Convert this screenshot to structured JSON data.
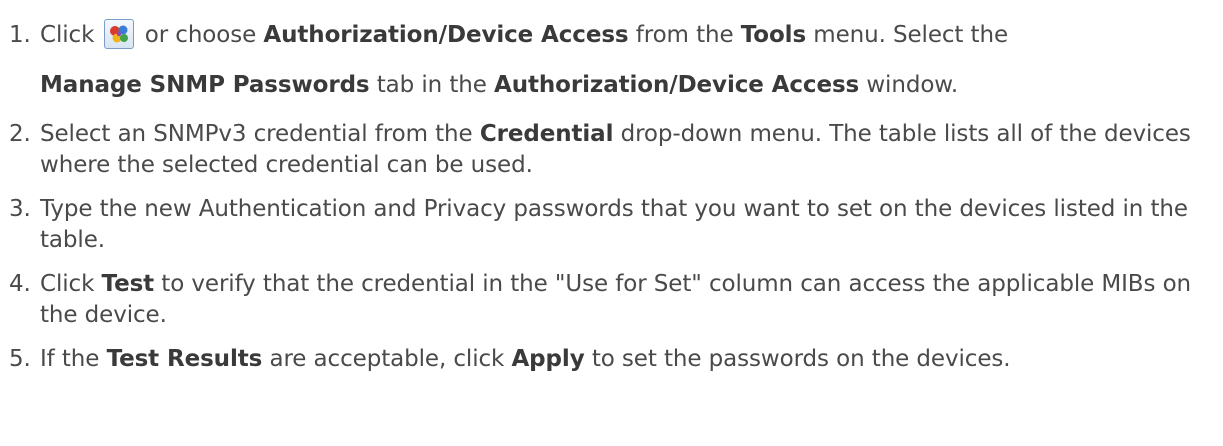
{
  "steps": [
    {
      "num": "1.",
      "click": "Click",
      "or_choose": "or choose",
      "menu_item": "Authorization/Device Access",
      "from_the": "from the",
      "menu": "Tools",
      "menu_suffix": "menu. Select the",
      "tab": "Manage SNMP Passwords",
      "tab_in_the": "tab in the",
      "window_name": "Authorization/Device Access",
      "window_suffix": "window."
    },
    {
      "num": "2.",
      "prefix": "Select an SNMPv3 credential from the",
      "field": "Credential",
      "suffix": "drop-down menu. The table lists all of the devices where the selected credential can be used."
    },
    {
      "num": "3.",
      "text": "Type the new Authentication and Privacy passwords that you want to set on the devices listed in the table."
    },
    {
      "num": "4.",
      "prefix": "Click",
      "button": "Test",
      "suffix": "to verify that the credential in the \"Use for Set\" column can access the applicable MIBs on the device."
    },
    {
      "num": "5.",
      "prefix": "If the",
      "results": "Test Results",
      "middle": "are acceptable, click",
      "button": "Apply",
      "suffix": "to set the passwords on the devices."
    }
  ],
  "icons": {
    "toolbar_button": "authorization-device-access-icon"
  }
}
